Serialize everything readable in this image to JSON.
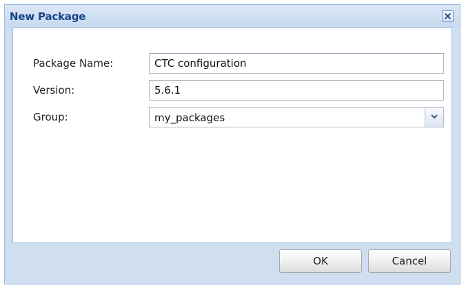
{
  "dialog": {
    "title": "New Package",
    "close_icon": "close-icon"
  },
  "form": {
    "package_name": {
      "label": "Package Name:",
      "value": "CTC configuration"
    },
    "version": {
      "label": "Version:",
      "value": "5.6.1"
    },
    "group": {
      "label": "Group:",
      "value": "my_packages",
      "trigger_icon": "chevron-down-icon"
    }
  },
  "buttons": {
    "ok_label": "OK",
    "cancel_label": "Cancel"
  },
  "colors": {
    "title_text": "#15428b",
    "frame_background": "#cfdff0",
    "frame_border": "#99bbe8"
  }
}
